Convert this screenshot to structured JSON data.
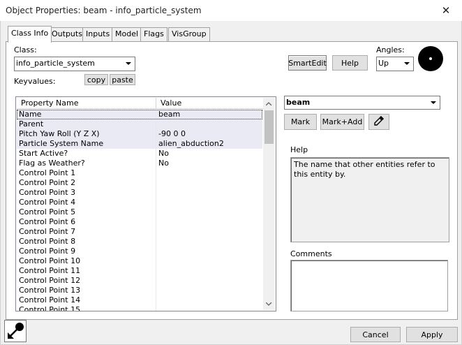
{
  "window": {
    "title": "Object Properties: beam - info_particle_system",
    "close_glyph": "✕"
  },
  "tabs": [
    {
      "label": "Class Info",
      "active": true
    },
    {
      "label": "Outputs",
      "active": false
    },
    {
      "label": "Inputs",
      "active": false
    },
    {
      "label": "Model",
      "active": false
    },
    {
      "label": "Flags",
      "active": false
    },
    {
      "label": "VisGroup",
      "active": false
    }
  ],
  "class_info": {
    "class_label": "Class:",
    "class_value": "info_particle_system",
    "keyvalues_label": "Keyvalues:",
    "copy_label": "copy",
    "paste_label": "paste",
    "smartedit_label": "SmartEdit",
    "help_label": "Help",
    "angles_label": "Angles:",
    "angles_value": "Up"
  },
  "property_list": {
    "col_name": "Property Name",
    "col_value": "Value",
    "rows": [
      {
        "name": "Name",
        "value": "beam"
      },
      {
        "name": "Parent",
        "value": ""
      },
      {
        "name": "Pitch Yaw Roll (Y Z X)",
        "value": "-90 0 0"
      },
      {
        "name": "Particle System Name",
        "value": "alien_abduction2"
      },
      {
        "name": "Start Active?",
        "value": "No"
      },
      {
        "name": "Flag as Weather?",
        "value": "No"
      },
      {
        "name": "Control Point 1",
        "value": ""
      },
      {
        "name": "Control Point 2",
        "value": ""
      },
      {
        "name": "Control Point 3",
        "value": ""
      },
      {
        "name": "Control Point 4",
        "value": ""
      },
      {
        "name": "Control Point 5",
        "value": ""
      },
      {
        "name": "Control Point 6",
        "value": ""
      },
      {
        "name": "Control Point 7",
        "value": ""
      },
      {
        "name": "Control Point 8",
        "value": ""
      },
      {
        "name": "Control Point 9",
        "value": ""
      },
      {
        "name": "Control Point 10",
        "value": ""
      },
      {
        "name": "Control Point 11",
        "value": ""
      },
      {
        "name": "Control Point 12",
        "value": ""
      },
      {
        "name": "Control Point 13",
        "value": ""
      },
      {
        "name": "Control Point 14",
        "value": ""
      },
      {
        "name": "Control Point 15",
        "value": ""
      }
    ]
  },
  "value_editor": {
    "value": "beam",
    "mark_label": "Mark",
    "markadd_label": "Mark+Add",
    "help_heading": "Help",
    "help_text": "The name that other entities refer to this entity by.",
    "comments_heading": "Comments"
  },
  "footer": {
    "cancel_label": "Cancel",
    "apply_label": "Apply"
  },
  "icons": {
    "close": "close-icon",
    "eyedropper": "eyedropper-icon",
    "angle_ball": "angle-compass-icon",
    "pointer": "pick-pointer-icon"
  }
}
